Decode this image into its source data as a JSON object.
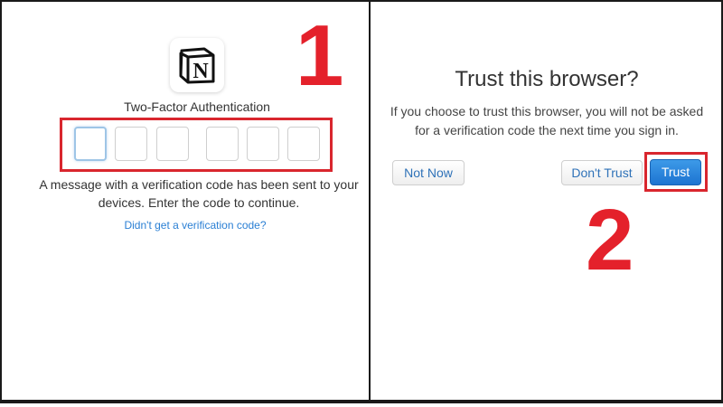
{
  "left_panel": {
    "logo": {
      "icon": "notion-logo-icon",
      "letter": "N"
    },
    "title": "Two-Factor Authentication",
    "otp": {
      "digit_count": 6,
      "active_index": 0
    },
    "message": "A message with a verification code has been sent to your devices. Enter the code to continue.",
    "resend_link": "Didn't get a verification code?"
  },
  "right_panel": {
    "title": "Trust this browser?",
    "description": "If you choose to trust this browser, you will not be asked for a verification code the next time you sign in.",
    "buttons": {
      "not_now": "Not Now",
      "dont_trust": "Don't Trust",
      "trust": "Trust"
    }
  },
  "annotations": {
    "step_1": "1",
    "step_2": "2",
    "highlight_color": "#d9262e"
  },
  "colors": {
    "link": "#2a7fd4",
    "primary_button": "#1d74d1"
  }
}
